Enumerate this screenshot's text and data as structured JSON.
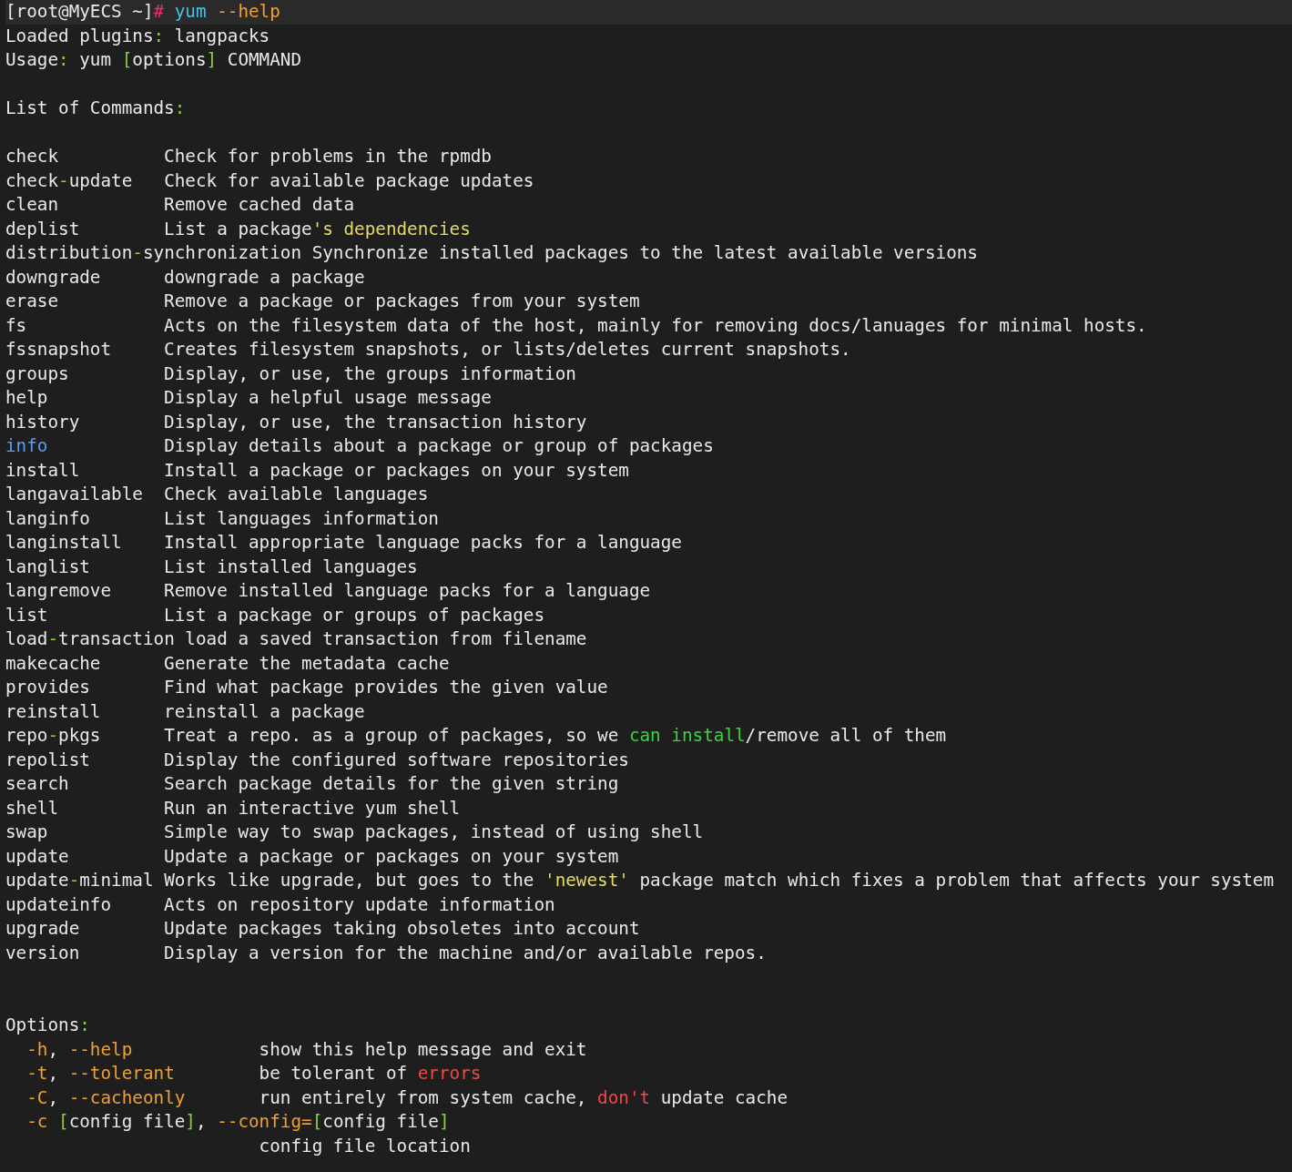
{
  "terminal": {
    "lines": [
      {
        "kind": "prompt",
        "segments": [
          {
            "text": "[root@MyECS ~]",
            "color": "#e8e8e8"
          },
          {
            "text": "# ",
            "color": "#e8316a"
          },
          {
            "text": "yum ",
            "color": "#4fc1e0"
          },
          {
            "text": "--help",
            "color": "#f0a030"
          }
        ]
      },
      {
        "kind": "text",
        "segments": [
          {
            "text": "Loaded plugins",
            "color": "#e8e8e8"
          },
          {
            "text": ":",
            "color": "#8ccf3b"
          },
          {
            "text": " langpacks",
            "color": "#e8e8e8"
          }
        ]
      },
      {
        "kind": "text",
        "segments": [
          {
            "text": "Usage",
            "color": "#e8e8e8"
          },
          {
            "text": ":",
            "color": "#8ccf3b"
          },
          {
            "text": " yum ",
            "color": "#e8e8e8"
          },
          {
            "text": "[",
            "color": "#8ccf3b"
          },
          {
            "text": "options",
            "color": "#e8e8e8"
          },
          {
            "text": "]",
            "color": "#8ccf3b"
          },
          {
            "text": " COMMAND",
            "color": "#e8e8e8"
          }
        ]
      },
      {
        "kind": "blank"
      },
      {
        "kind": "text",
        "segments": [
          {
            "text": "List of Commands",
            "color": "#e8e8e8"
          },
          {
            "text": ":",
            "color": "#8ccf3b"
          }
        ]
      },
      {
        "kind": "blank"
      },
      {
        "kind": "text",
        "segments": [
          {
            "text": "check          Check for problems in the rpmdb",
            "color": "#e8e8e8"
          }
        ]
      },
      {
        "kind": "text",
        "segments": [
          {
            "text": "check",
            "color": "#e8e8e8"
          },
          {
            "text": "-",
            "color": "#8ccf3b"
          },
          {
            "text": "update   Check for available package updates",
            "color": "#e8e8e8"
          }
        ]
      },
      {
        "kind": "text",
        "segments": [
          {
            "text": "clean          Remove cached data",
            "color": "#e8e8e8"
          }
        ]
      },
      {
        "kind": "text",
        "segments": [
          {
            "text": "deplist        List a package",
            "color": "#e8e8e8"
          },
          {
            "text": "'s dependencies",
            "color": "#e5d96a"
          }
        ]
      },
      {
        "kind": "text",
        "segments": [
          {
            "text": "distribution",
            "color": "#e8e8e8"
          },
          {
            "text": "-",
            "color": "#8ccf3b"
          },
          {
            "text": "synchronization Synchronize installed packages to the latest available versions",
            "color": "#e8e8e8"
          }
        ]
      },
      {
        "kind": "text",
        "segments": [
          {
            "text": "downgrade      downgrade a package",
            "color": "#e8e8e8"
          }
        ]
      },
      {
        "kind": "text",
        "segments": [
          {
            "text": "erase          Remove a package or packages from your system",
            "color": "#e8e8e8"
          }
        ]
      },
      {
        "kind": "text",
        "segments": [
          {
            "text": "fs             Acts on the filesystem data of the host, mainly for removing docs/lanuages for minimal hosts.",
            "color": "#e8e8e8"
          }
        ]
      },
      {
        "kind": "text",
        "segments": [
          {
            "text": "fssnapshot     Creates filesystem snapshots, or lists/deletes current snapshots.",
            "color": "#e8e8e8"
          }
        ]
      },
      {
        "kind": "text",
        "segments": [
          {
            "text": "groups         Display, or use, the groups information",
            "color": "#e8e8e8"
          }
        ]
      },
      {
        "kind": "text",
        "segments": [
          {
            "text": "help           Display a helpful usage message",
            "color": "#e8e8e8"
          }
        ]
      },
      {
        "kind": "text",
        "segments": [
          {
            "text": "history        Display, or use, the transaction history",
            "color": "#e8e8e8"
          }
        ]
      },
      {
        "kind": "text",
        "segments": [
          {
            "text": "info",
            "color": "#5b9bf0"
          },
          {
            "text": "           Display details about a package or group of packages",
            "color": "#e8e8e8"
          }
        ]
      },
      {
        "kind": "text",
        "segments": [
          {
            "text": "install        Install a package or packages on your system",
            "color": "#e8e8e8"
          }
        ]
      },
      {
        "kind": "text",
        "segments": [
          {
            "text": "langavailable  Check available languages",
            "color": "#e8e8e8"
          }
        ]
      },
      {
        "kind": "text",
        "segments": [
          {
            "text": "langinfo       List languages information",
            "color": "#e8e8e8"
          }
        ]
      },
      {
        "kind": "text",
        "segments": [
          {
            "text": "langinstall    Install appropriate language packs for a language",
            "color": "#e8e8e8"
          }
        ]
      },
      {
        "kind": "text",
        "segments": [
          {
            "text": "langlist       List installed languages",
            "color": "#e8e8e8"
          }
        ]
      },
      {
        "kind": "text",
        "segments": [
          {
            "text": "langremove     Remove installed language packs for a language",
            "color": "#e8e8e8"
          }
        ]
      },
      {
        "kind": "text",
        "segments": [
          {
            "text": "list           List a package or groups of packages",
            "color": "#e8e8e8"
          }
        ]
      },
      {
        "kind": "text",
        "segments": [
          {
            "text": "load",
            "color": "#e8e8e8"
          },
          {
            "text": "-",
            "color": "#8ccf3b"
          },
          {
            "text": "transaction load a saved transaction from filename",
            "color": "#e8e8e8"
          }
        ]
      },
      {
        "kind": "text",
        "segments": [
          {
            "text": "makecache      Generate the metadata cache",
            "color": "#e8e8e8"
          }
        ]
      },
      {
        "kind": "text",
        "segments": [
          {
            "text": "provides       Find what package provides the given value",
            "color": "#e8e8e8"
          }
        ]
      },
      {
        "kind": "text",
        "segments": [
          {
            "text": "reinstall      reinstall a package",
            "color": "#e8e8e8"
          }
        ]
      },
      {
        "kind": "text",
        "segments": [
          {
            "text": "repo",
            "color": "#e8e8e8"
          },
          {
            "text": "-",
            "color": "#8ccf3b"
          },
          {
            "text": "pkgs      Treat a repo. as a group of packages, so we ",
            "color": "#e8e8e8"
          },
          {
            "text": "can install",
            "color": "#3cd23c"
          },
          {
            "text": "/remove all of them",
            "color": "#e8e8e8"
          }
        ]
      },
      {
        "kind": "text",
        "segments": [
          {
            "text": "repolist       Display the configured software repositories",
            "color": "#e8e8e8"
          }
        ]
      },
      {
        "kind": "text",
        "segments": [
          {
            "text": "search         Search package details for the given string",
            "color": "#e8e8e8"
          }
        ]
      },
      {
        "kind": "text",
        "segments": [
          {
            "text": "shell          Run an interactive yum shell",
            "color": "#e8e8e8"
          }
        ]
      },
      {
        "kind": "text",
        "segments": [
          {
            "text": "swap           Simple way to swap packages, instead of using shell",
            "color": "#e8e8e8"
          }
        ]
      },
      {
        "kind": "text",
        "segments": [
          {
            "text": "update         Update a package or packages on your system",
            "color": "#e8e8e8"
          }
        ]
      },
      {
        "kind": "text",
        "segments": [
          {
            "text": "update",
            "color": "#e8e8e8"
          },
          {
            "text": "-",
            "color": "#8ccf3b"
          },
          {
            "text": "minimal Works like upgrade, but goes to the ",
            "color": "#e8e8e8"
          },
          {
            "text": "'newest'",
            "color": "#e5d96a"
          },
          {
            "text": " package match which fixes a problem that affects your system",
            "color": "#e8e8e8"
          }
        ]
      },
      {
        "kind": "text",
        "segments": [
          {
            "text": "updateinfo     Acts on repository update information",
            "color": "#e8e8e8"
          }
        ]
      },
      {
        "kind": "text",
        "segments": [
          {
            "text": "upgrade        Update packages taking obsoletes into account",
            "color": "#e8e8e8"
          }
        ]
      },
      {
        "kind": "text",
        "segments": [
          {
            "text": "version        Display a version for the machine and/or available repos.",
            "color": "#e8e8e8"
          }
        ]
      },
      {
        "kind": "blank"
      },
      {
        "kind": "blank"
      },
      {
        "kind": "text",
        "segments": [
          {
            "text": "Options",
            "color": "#e8e8e8"
          },
          {
            "text": ":",
            "color": "#8ccf3b"
          }
        ]
      },
      {
        "kind": "text",
        "segments": [
          {
            "text": "  -h",
            "color": "#f0a030"
          },
          {
            "text": ", ",
            "color": "#e8e8e8"
          },
          {
            "text": "--help",
            "color": "#f0a030"
          },
          {
            "text": "            show this help message and exit",
            "color": "#e8e8e8"
          }
        ]
      },
      {
        "kind": "text",
        "segments": [
          {
            "text": "  -t",
            "color": "#f0a030"
          },
          {
            "text": ", ",
            "color": "#e8e8e8"
          },
          {
            "text": "--tolerant",
            "color": "#f0a030"
          },
          {
            "text": "        be tolerant of ",
            "color": "#e8e8e8"
          },
          {
            "text": "errors",
            "color": "#f04848"
          }
        ]
      },
      {
        "kind": "text",
        "segments": [
          {
            "text": "  -C",
            "color": "#f0a030"
          },
          {
            "text": ", ",
            "color": "#e8e8e8"
          },
          {
            "text": "--cacheonly",
            "color": "#f0a030"
          },
          {
            "text": "       run entirely from system cache, ",
            "color": "#e8e8e8"
          },
          {
            "text": "don't",
            "color": "#f04848"
          },
          {
            "text": " update cache",
            "color": "#e8e8e8"
          }
        ]
      },
      {
        "kind": "text",
        "segments": [
          {
            "text": "  -c ",
            "color": "#f0a030"
          },
          {
            "text": "[",
            "color": "#8ccf3b"
          },
          {
            "text": "config file",
            "color": "#e8e8e8"
          },
          {
            "text": "]",
            "color": "#8ccf3b"
          },
          {
            "text": ", ",
            "color": "#e8e8e8"
          },
          {
            "text": "--config=",
            "color": "#f0a030"
          },
          {
            "text": "[",
            "color": "#8ccf3b"
          },
          {
            "text": "config file",
            "color": "#e8e8e8"
          },
          {
            "text": "]",
            "color": "#8ccf3b"
          }
        ]
      },
      {
        "kind": "text",
        "segments": [
          {
            "text": "                        config file location",
            "color": "#e8e8e8"
          }
        ]
      }
    ]
  }
}
